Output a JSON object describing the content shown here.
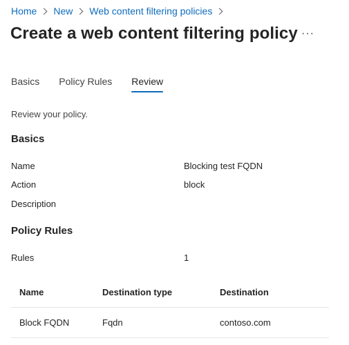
{
  "breadcrumb": {
    "items": [
      "Home",
      "New",
      "Web content filtering policies"
    ]
  },
  "page": {
    "title": "Create a web content filtering policy",
    "more_label": "···"
  },
  "tabs": [
    {
      "label": "Basics",
      "active": false
    },
    {
      "label": "Policy Rules",
      "active": false
    },
    {
      "label": "Review",
      "active": true
    }
  ],
  "review": {
    "intro": "Review your policy.",
    "basics": {
      "heading": "Basics",
      "fields": [
        {
          "label": "Name",
          "value": "Blocking test FQDN"
        },
        {
          "label": "Action",
          "value": "block"
        },
        {
          "label": "Description",
          "value": ""
        }
      ]
    },
    "policy_rules": {
      "heading": "Policy Rules",
      "rules_label": "Rules",
      "rules_count": "1",
      "table": {
        "columns": [
          "Name",
          "Destination type",
          "Destination"
        ],
        "rows": [
          [
            "Block FQDN",
            "Fqdn",
            "contoso.com"
          ]
        ]
      }
    }
  }
}
